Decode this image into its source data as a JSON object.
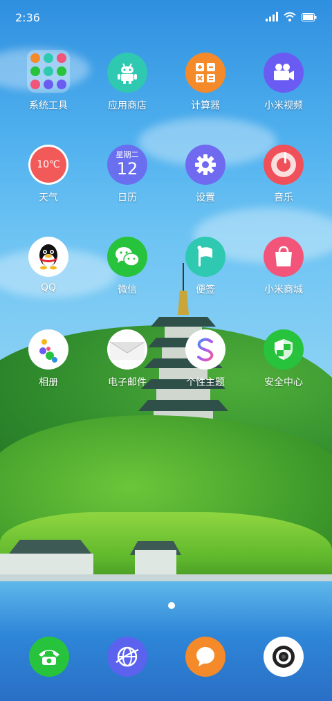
{
  "status_bar": {
    "time": "2:36",
    "icons": [
      "signal-icon",
      "wifi-icon",
      "battery-icon"
    ]
  },
  "apps": [
    {
      "label": "系统工具",
      "icon": "folder-icon"
    },
    {
      "label": "应用商店",
      "icon": "robot-icon",
      "color": "#2ec9b0"
    },
    {
      "label": "计算器",
      "icon": "calculator-icon",
      "color": "#f58a2a"
    },
    {
      "label": "小米视频",
      "icon": "video-camera-icon",
      "color": "#6a5cf2"
    },
    {
      "label": "天气",
      "icon": "weather-icon",
      "color": "#f25a5a",
      "value": "10℃"
    },
    {
      "label": "日历",
      "icon": "calendar-icon",
      "color": "#6a6ff0",
      "weekday": "星期二",
      "day": "12"
    },
    {
      "label": "设置",
      "icon": "gear-icon",
      "color": "#6f6af0"
    },
    {
      "label": "音乐",
      "icon": "music-icon",
      "color": "#f0505a"
    },
    {
      "label": "QQ",
      "icon": "penguin-icon",
      "color": "#ffffff"
    },
    {
      "label": "微信",
      "icon": "chat-bubbles-icon",
      "color": "#27c33d"
    },
    {
      "label": "便签",
      "icon": "flag-icon",
      "color": "#2ec9b0"
    },
    {
      "label": "小米商城",
      "icon": "shopping-bag-icon",
      "color": "#f2547a"
    },
    {
      "label": "相册",
      "icon": "gallery-dots-icon",
      "color": "#ffffff"
    },
    {
      "label": "电子邮件",
      "icon": "envelope-icon",
      "color": "#ffffff"
    },
    {
      "label": "个性主题",
      "icon": "theme-s-icon",
      "color": "#ffffff"
    },
    {
      "label": "安全中心",
      "icon": "shield-icon",
      "color": "#27c33d"
    }
  ],
  "dock": [
    {
      "icon": "phone-icon",
      "color": "#27c33d"
    },
    {
      "icon": "browser-globe-icon",
      "color": "#5a62ee"
    },
    {
      "icon": "message-bubble-icon",
      "color": "#f58a2a"
    },
    {
      "icon": "camera-lens-icon",
      "color": "#ffffff"
    }
  ]
}
